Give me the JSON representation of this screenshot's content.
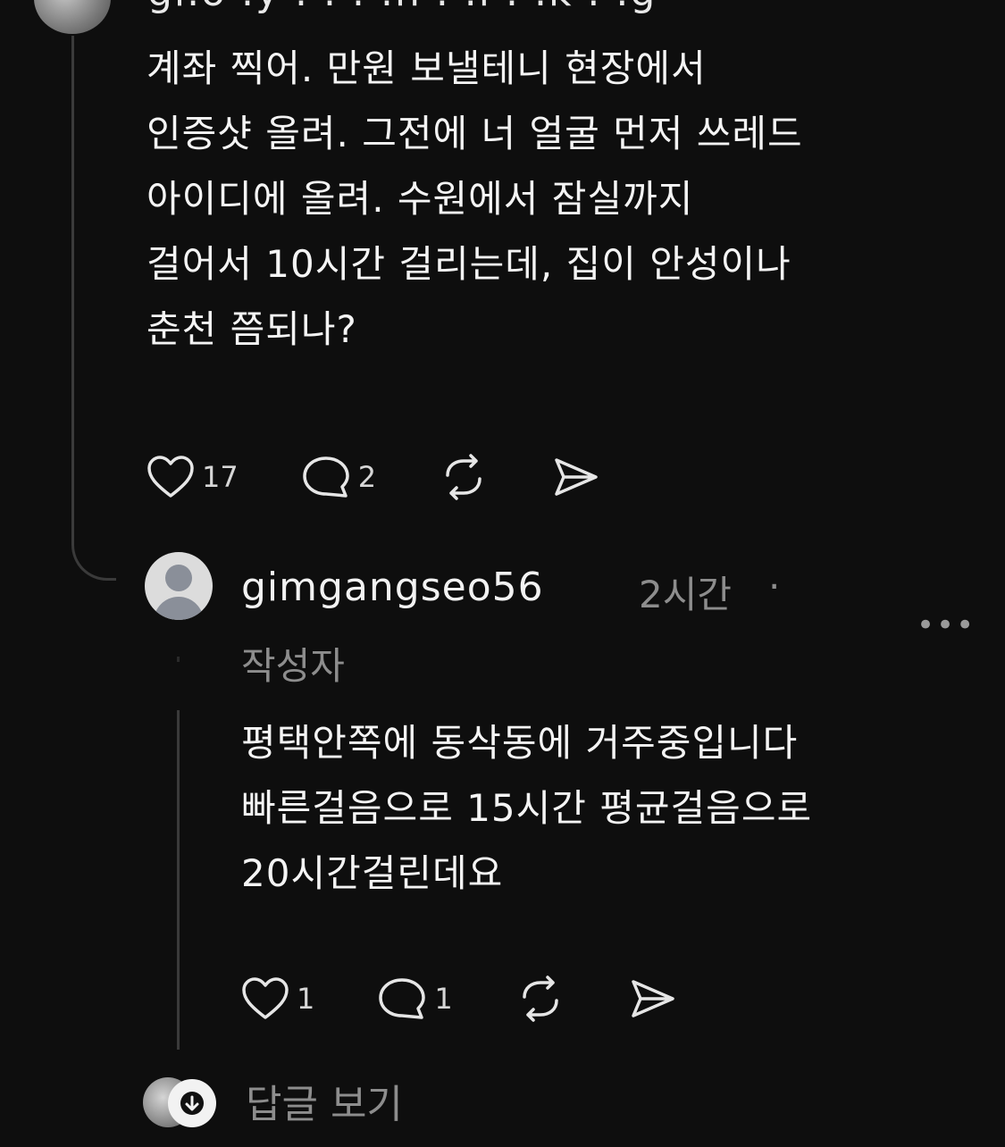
{
  "post1": {
    "header_cut": "gi.o .y . . . .h . .l . .k . .g",
    "text": "계좌 찍어. 만원 보낼테니 현장에서\n인증샷 올려. 그전에 너 얼굴 먼저 쓰레드\n아이디에 올려. 수원에서 잠실까지\n걸어서 10시간 걸리는데, 집이 안성이나\n춘천 쯤되나?",
    "like_count": "17",
    "comment_count": "2"
  },
  "reply": {
    "username": "gimgangseo56",
    "time": "2시간",
    "separator": "·",
    "author_badge": "작성자",
    "more": "•••",
    "text": "평택안쪽에 동삭동에 거주중입니다\n빠른걸음으로 15시간 평균걸음으로\n20시간걸린데요",
    "like_count": "1",
    "comment_count": "1"
  },
  "view_replies": {
    "label": "답글 보기"
  },
  "icons": {
    "like": "heart-icon",
    "comment": "comment-bubble-icon",
    "repost": "repost-icon",
    "share": "send-icon",
    "expand": "arrow-down-icon"
  },
  "colors": {
    "background": "#0e0e0e",
    "text": "#f4f4f4",
    "muted": "#8d8d8d"
  }
}
